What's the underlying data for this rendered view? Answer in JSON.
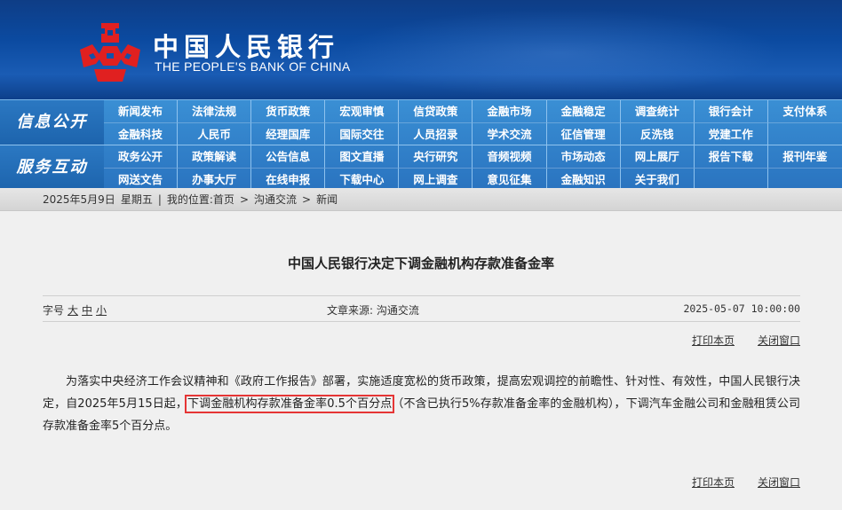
{
  "header": {
    "title_cn": "中国人民银行",
    "title_en": "THE PEOPLE'S BANK OF CHINA",
    "logo_icon": "pboc-coin-logo-icon",
    "colors": {
      "header_bg": "#0b4aa0",
      "logo": "#e02020",
      "nav_bg": "#2a74c0"
    }
  },
  "nav": {
    "sections": [
      {
        "title": "信息公开",
        "rows": [
          [
            "新闻发布",
            "法律法规",
            "货币政策",
            "宏观审慎",
            "信贷政策",
            "金融市场",
            "金融稳定",
            "调查统计",
            "银行会计",
            "支付体系"
          ],
          [
            "金融科技",
            "人民币",
            "经理国库",
            "国际交往",
            "人员招录",
            "学术交流",
            "征信管理",
            "反洗钱",
            "党建工作",
            ""
          ]
        ]
      },
      {
        "title": "服务互动",
        "rows": [
          [
            "政务公开",
            "政策解读",
            "公告信息",
            "图文直播",
            "央行研究",
            "音频视频",
            "市场动态",
            "网上展厅",
            "报告下载",
            "报刊年鉴"
          ],
          [
            "网送文告",
            "办事大厅",
            "在线申报",
            "下载中心",
            "网上调查",
            "意见征集",
            "金融知识",
            "关于我们",
            "",
            ""
          ]
        ]
      }
    ]
  },
  "breadcrumb": {
    "date": "2025年5月9日",
    "weekday": "星期五",
    "sep": "|",
    "location_label": "我的位置:",
    "items": [
      "首页",
      ">",
      "沟通交流",
      ">",
      "新闻"
    ]
  },
  "article": {
    "title": "中国人民银行决定下调金融机构存款准备金率",
    "font_size_label": "字号",
    "font_sizes": [
      "大",
      "中",
      "小"
    ],
    "source": "文章来源: 沟通交流",
    "date": "2025-05-07 10:00:00",
    "print_label": "打印本页",
    "close_label": "关闭窗口",
    "body_before": "为落实中央经济工作会议精神和《政府工作报告》部署，实施适度宽松的货币政策，提高宏观调控的前瞻性、针对性、有效性，中国人民银行决定，自2025年5月15日起，",
    "body_highlight": "下调金融机构存款准备金率0.5个百分点",
    "body_after": "（不含已执行5%存款准备金率的金融机构），下调汽车金融公司和金融租赁公司存款准备金率5个百分点。"
  }
}
